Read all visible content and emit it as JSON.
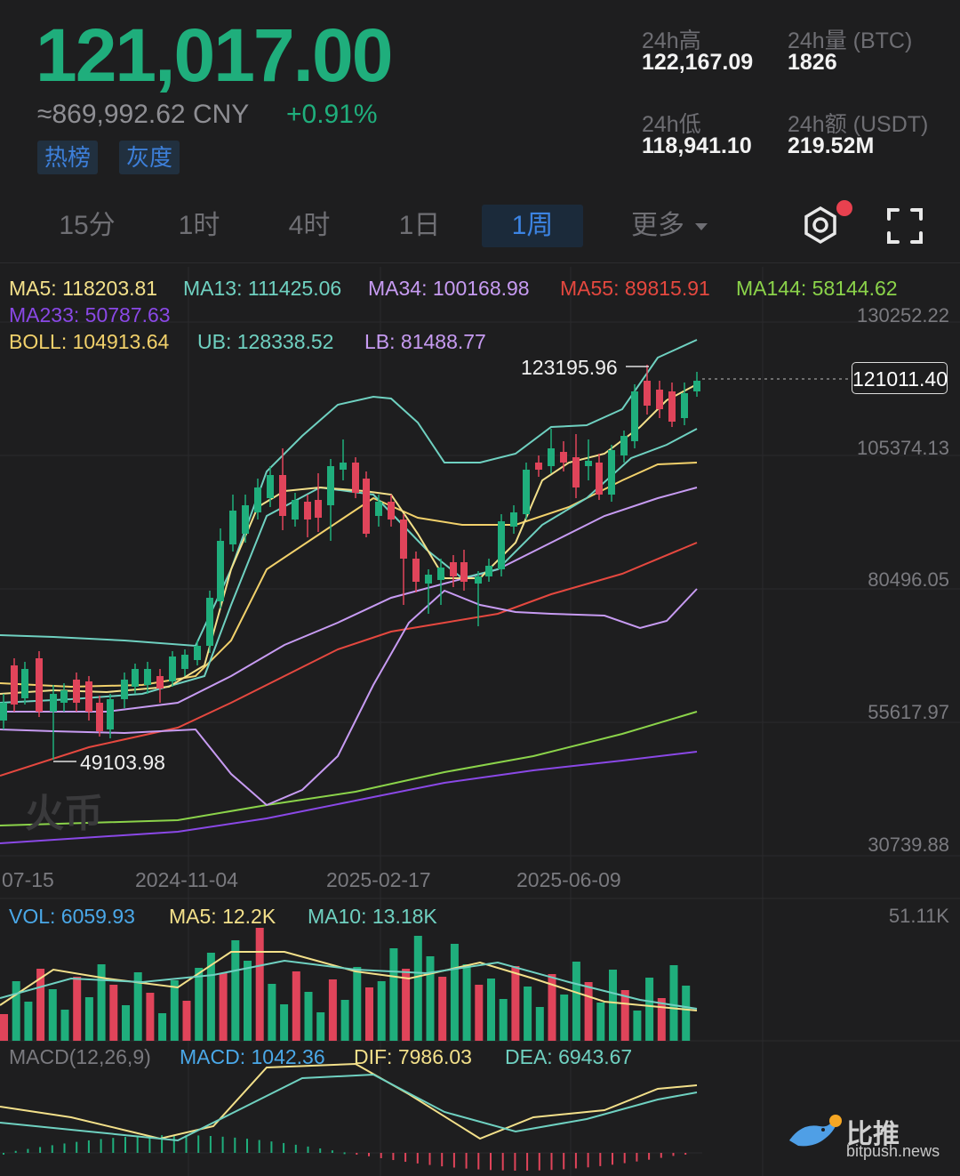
{
  "header": {
    "price": "121,017.00",
    "cny": "≈869,992.62 CNY",
    "change": "+0.91%",
    "tags": [
      "热榜",
      "灰度"
    ],
    "stats": {
      "high_label": "24h高",
      "high_value": "122,167.09",
      "vol_label": "24h量 (BTC)",
      "vol_value": "1826",
      "low_label": "24h低",
      "low_value": "118,941.10",
      "amt_label": "24h额 (USDT)",
      "amt_value": "219.52M"
    }
  },
  "tabs": {
    "items": [
      "15分",
      "1时",
      "4时",
      "1日",
      "1周",
      "更多"
    ],
    "active": "1周"
  },
  "main_chart": {
    "indicators": {
      "ma5": "MA5: 118203.81",
      "ma13": "MA13: 111425.06",
      "ma34": "MA34: 100168.98",
      "ma55": "MA55: 89815.91",
      "ma144": "MA144: 58144.62",
      "ma233": "MA233: 50787.63",
      "boll": "BOLL: 104913.64",
      "ub": "UB: 128338.52",
      "lb": "LB: 81488.77"
    },
    "y_axis": [
      "130252.22",
      "105374.13",
      "80496.05",
      "55617.97",
      "30739.88"
    ],
    "x_axis": [
      "07-15",
      "2024-11-04",
      "2025-02-17",
      "2025-06-09"
    ],
    "high_annotation": "123195.96",
    "low_annotation": "49103.98",
    "last_price": "121011.40",
    "watermark": "火币"
  },
  "volume_chart": {
    "vol": "VOL: 6059.93",
    "ma5": "MA5: 12.2K",
    "ma10": "MA10: 13.18K",
    "y_max": "51.11K"
  },
  "macd_chart": {
    "title": "MACD(12,26,9)",
    "macd": "MACD: 1042.36",
    "dif": "DIF: 7986.03",
    "dea": "DEA: 6943.67"
  },
  "branding": {
    "name": "比推",
    "url": "bitpush.news"
  },
  "colors": {
    "up": "#1fae7c",
    "down": "#e0445a",
    "accent": "#3c84e3",
    "ma5": "#f3e08a",
    "ma13": "#6fd1c1",
    "ma34": "#c79bf2",
    "ma55": "#e5483f",
    "ma144": "#8bd34a",
    "ma233": "#8a48e6",
    "boll": "#f2d16b"
  }
}
